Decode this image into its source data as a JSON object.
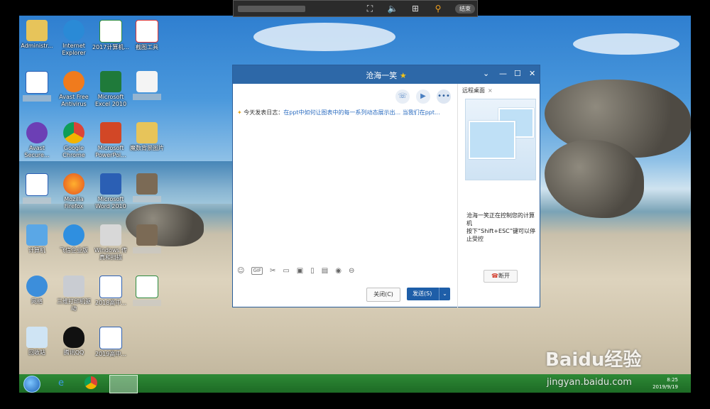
{
  "remote_toolbar": {
    "end_label": "结束"
  },
  "desktop_icons": [
    {
      "label": "Administr..."
    },
    {
      "label": "Internet Explorer"
    },
    {
      "label": "2017计算机..."
    },
    {
      "label": "截图工具"
    },
    {
      "label": "Avast Free Antivirus"
    },
    {
      "label": "Microsoft Excel 2010"
    },
    {
      "label": "Avast Secure..."
    },
    {
      "label": "Google Chrome"
    },
    {
      "label": "Microsoft PowerPoi..."
    },
    {
      "label": "魔数背景图片"
    },
    {
      "label": "Mozilla Firefox"
    },
    {
      "label": "Microsoft Word 2010"
    },
    {
      "label": "计算机"
    },
    {
      "label": "飞信企业版"
    },
    {
      "label": "Windows 传真和扫描"
    },
    {
      "label": "网络"
    },
    {
      "label": "三维打印机驱动"
    },
    {
      "label": "2018高中..."
    },
    {
      "label": "回收站"
    },
    {
      "label": "腾讯QQ"
    },
    {
      "label": "2019高中..."
    }
  ],
  "chat": {
    "title": "沧海一笑",
    "log_prefix": "今天发表日志：",
    "log_link": "在ppt中如何让图表中的每一系列动态展示出...",
    "log_tail": "当我们在ppt...",
    "close_label": "关闭(C)",
    "send_label": "发送(S)",
    "remote_tab": "远程桌面",
    "remote_msg_1": "沧海一笑正在控制您的计算机",
    "remote_msg_2": "按下“Shift+ESC”键可以停止受控",
    "disconnect_label": "断开"
  },
  "taskbar": {
    "time": "8:25",
    "date": "2019/9/19"
  },
  "watermark": {
    "brand": "Baidu经验",
    "url": "jingyan.baidu.com"
  }
}
